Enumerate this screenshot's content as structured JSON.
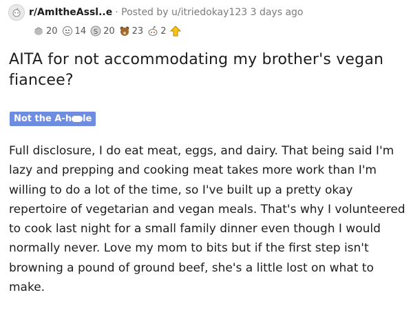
{
  "post": {
    "subreddit": "r/AmItheAssl..e",
    "meta": "· Posted by u/itriedokay123 3 days ago",
    "title": "AITA for not accommodating my brother's vegan fiancee?",
    "flair_pre": "Not the A-h",
    "flair_post": "le",
    "body": "Full disclosure, I do eat meat, eggs, and dairy. That being said I'm lazy and prepping and cooking meat takes more work than I'm willing to do a lot of the time, so I've built up a pretty okay repertoire of vegetarian and vegan meals. That's why I volunteered to cook last night for a small family dinner even though I would normally never. Love my mom to bits but if the first step isn't browning a pound of ground beef, she's a little lost on what to make."
  },
  "awards": [
    {
      "icon": "hands-award-icon",
      "count": "20"
    },
    {
      "icon": "face-award-icon",
      "count": "14"
    },
    {
      "icon": "silver-award-icon",
      "count": "20"
    },
    {
      "icon": "bear-award-icon",
      "count": "23"
    },
    {
      "icon": "snoo-award-icon",
      "count": "2"
    },
    {
      "icon": "upvote-award-icon",
      "count": ""
    }
  ],
  "colors": {
    "flair_bg": "#6f8de0",
    "muted": "#7c7c7c"
  }
}
